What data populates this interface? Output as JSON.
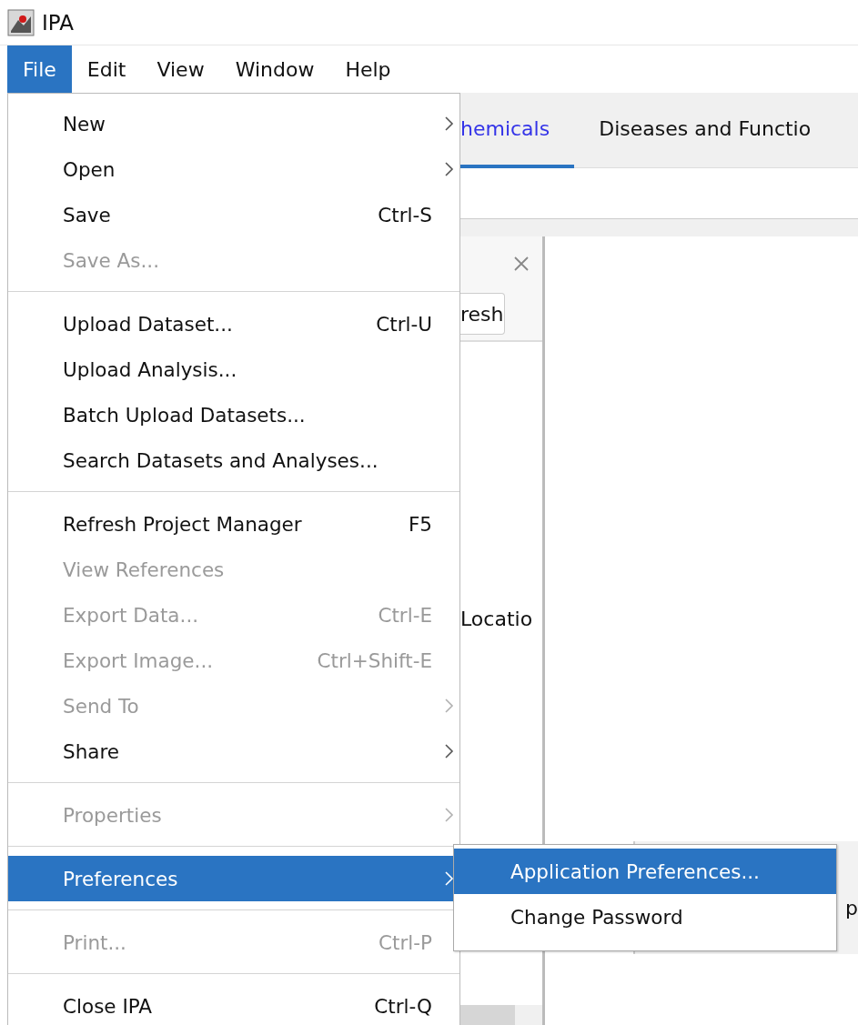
{
  "window": {
    "title": "IPA"
  },
  "menubar": [
    {
      "label": "File",
      "selected": true
    },
    {
      "label": "Edit",
      "selected": false
    },
    {
      "label": "View",
      "selected": false
    },
    {
      "label": "Window",
      "selected": false
    },
    {
      "label": "Help",
      "selected": false
    }
  ],
  "tabs": [
    {
      "label": "hemicals",
      "selected": true
    },
    {
      "label": "Diseases and Functio",
      "selected": false
    }
  ],
  "panel": {
    "button": "resh",
    "list_text": "Locatio"
  },
  "right_box_text": "p",
  "file_menu": [
    [
      {
        "label": "New",
        "submenu": true,
        "disabled": false,
        "selected": false
      },
      {
        "label": "Open",
        "submenu": true,
        "disabled": false,
        "selected": false
      },
      {
        "label": "Save",
        "shortcut": "Ctrl-S",
        "submenu": false,
        "disabled": false,
        "selected": false
      },
      {
        "label": "Save As...",
        "submenu": false,
        "disabled": true,
        "selected": false
      }
    ],
    [
      {
        "label": "Upload Dataset...",
        "shortcut": "Ctrl-U",
        "submenu": false,
        "disabled": false,
        "selected": false
      },
      {
        "label": "Upload Analysis...",
        "submenu": false,
        "disabled": false,
        "selected": false
      },
      {
        "label": "Batch Upload Datasets...",
        "submenu": false,
        "disabled": false,
        "selected": false
      },
      {
        "label": "Search Datasets and Analyses...",
        "submenu": false,
        "disabled": false,
        "selected": false
      }
    ],
    [
      {
        "label": "Refresh Project Manager",
        "shortcut": "F5",
        "submenu": false,
        "disabled": false,
        "selected": false
      },
      {
        "label": "View References",
        "submenu": false,
        "disabled": true,
        "selected": false
      },
      {
        "label": "Export Data...",
        "shortcut": "Ctrl-E",
        "submenu": false,
        "disabled": true,
        "selected": false
      },
      {
        "label": "Export Image...",
        "shortcut": "Ctrl+Shift-E",
        "submenu": false,
        "disabled": true,
        "selected": false
      },
      {
        "label": "Send To",
        "submenu": true,
        "disabled": true,
        "selected": false
      },
      {
        "label": "Share",
        "submenu": true,
        "disabled": false,
        "selected": false
      }
    ],
    [
      {
        "label": "Properties",
        "submenu": true,
        "disabled": true,
        "selected": false
      }
    ],
    [
      {
        "label": "Preferences",
        "submenu": true,
        "disabled": false,
        "selected": true
      }
    ],
    [
      {
        "label": "Print...",
        "shortcut": "Ctrl-P",
        "submenu": false,
        "disabled": true,
        "selected": false
      }
    ],
    [
      {
        "label": "Close IPA",
        "shortcut": "Ctrl-Q",
        "submenu": false,
        "disabled": false,
        "selected": false
      }
    ]
  ],
  "submenu": [
    {
      "label": "Application Preferences...",
      "selected": true
    },
    {
      "label": "Change Password",
      "selected": false
    }
  ]
}
